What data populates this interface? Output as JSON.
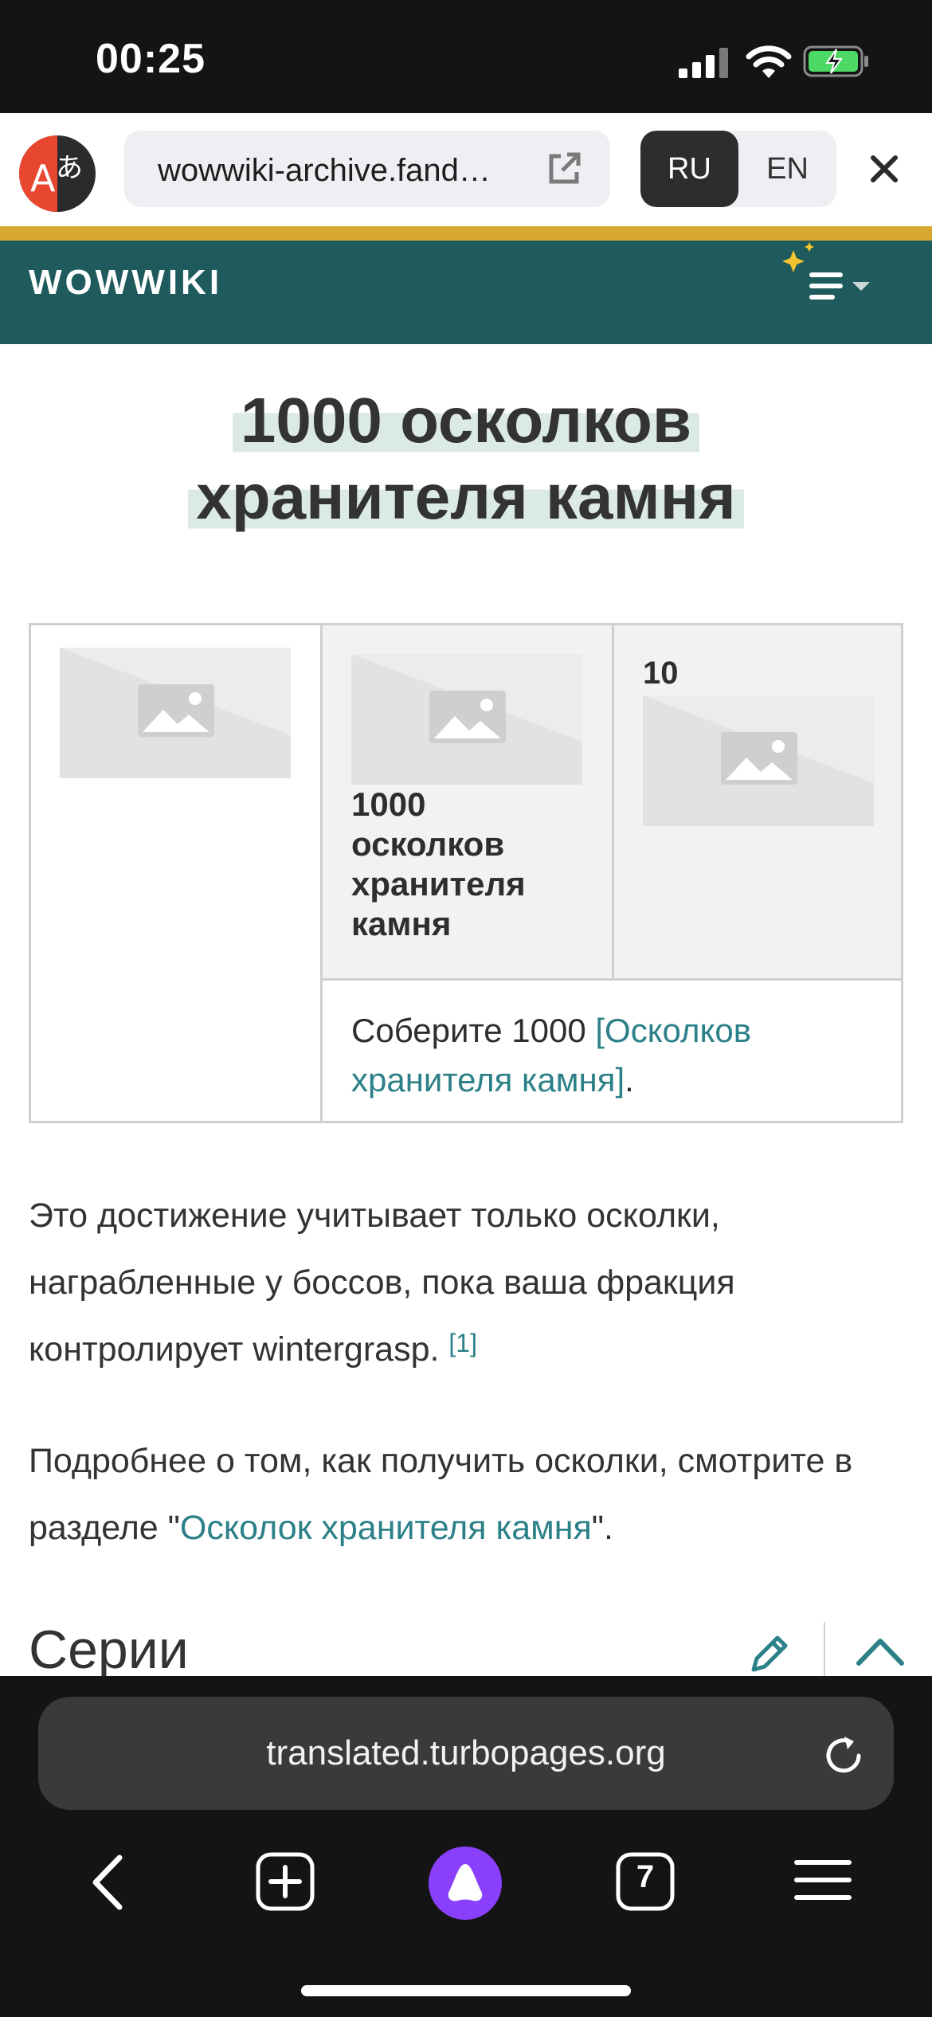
{
  "status_bar": {
    "time": "00:25"
  },
  "translate_bar": {
    "url": "wowwiki-archive.fand…",
    "lang_source": "RU",
    "lang_target": "EN"
  },
  "wiki": {
    "brand": "WOWWIKI"
  },
  "article": {
    "title_line1": "1000 осколков",
    "title_line2": "хранителя камня",
    "infobox": {
      "name_line1": "1000",
      "name_line2": "осколков",
      "name_line3": "хранителя",
      "name_line4": "камня",
      "points": "10",
      "description_prefix": "Соберите 1000 ",
      "description_link": "[Осколков хранителя камня]",
      "description_suffix": "."
    },
    "para1_text": "Это достижение учитывает только осколки, награбленные у боссов, пока ваша фракция контролирует wintergrasp. ",
    "para1_ref": "[1]",
    "para2_prefix": "Подробнее о том, как получить осколки, смотрите в разделе \"",
    "para2_link": "Осколок хранителя камня",
    "para2_suffix": "\".",
    "section_title": "Серии"
  },
  "browser": {
    "address": "translated.turbopages.org",
    "tabs_count": "7"
  }
}
